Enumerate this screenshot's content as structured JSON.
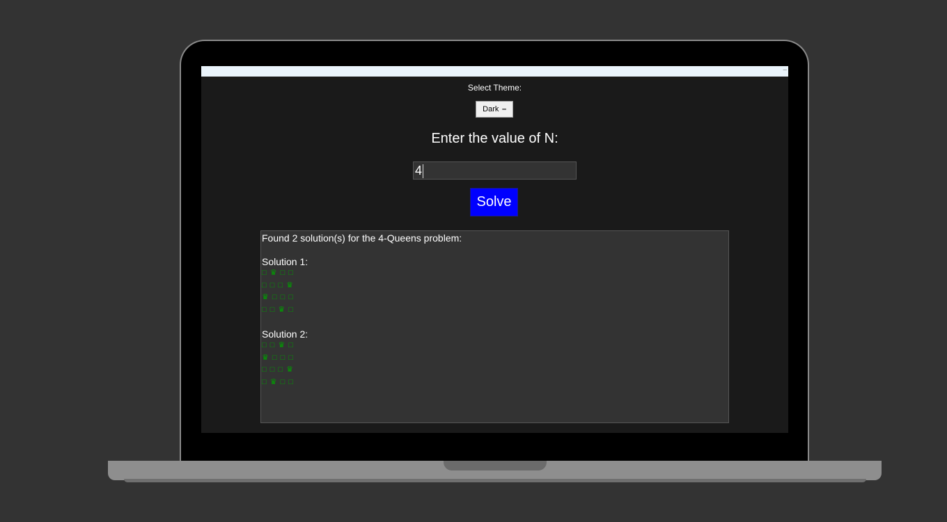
{
  "window": {
    "minimize_glyph": "–"
  },
  "theme": {
    "label": "Select Theme:",
    "selected": "Dark",
    "arrow_icon": "dropdown-arrow-icon"
  },
  "input": {
    "label": "Enter the value of N:",
    "value": "4"
  },
  "solve": {
    "label": "Solve",
    "color": "#0000ff"
  },
  "output": {
    "summary": "Found 2 solution(s) for the 4-Queens problem:",
    "board_color": "#00a000",
    "solutions": [
      {
        "title": "Solution 1:",
        "rows": [
          "□ ♛ □ □",
          "□ □ □ ♛",
          "♛ □ □ □",
          "□ □ ♛ □"
        ]
      },
      {
        "title": "Solution 2:",
        "rows": [
          "□ □ ♛ □",
          "♛ □ □ □",
          "□ □ □ ♛",
          "□ ♛ □ □"
        ]
      }
    ]
  }
}
